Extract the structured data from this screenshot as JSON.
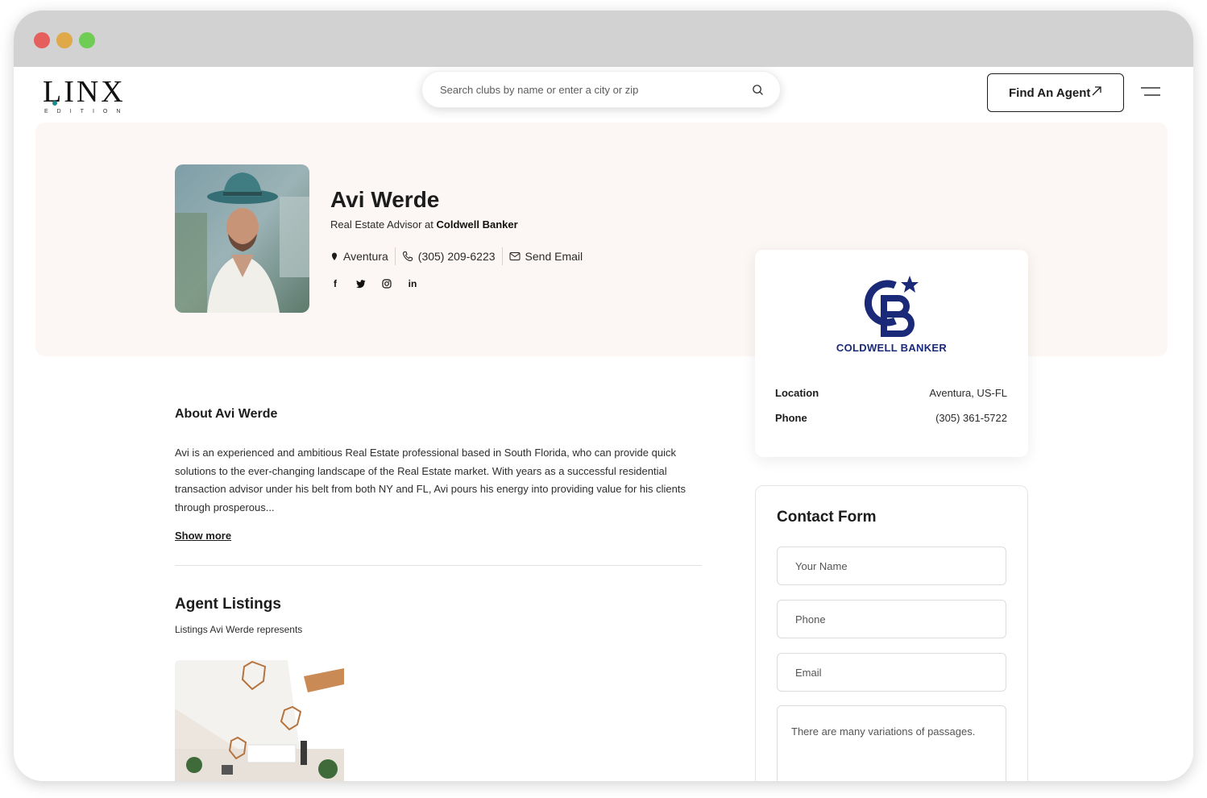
{
  "header": {
    "logo_text": "LINX",
    "logo_subtext": "EDITION",
    "search_placeholder": "Search clubs by name or enter a city or zip",
    "find_agent_label": "Find An Agent"
  },
  "agent": {
    "name": "Avi Werde",
    "role_prefix": "Real Estate Advisor at ",
    "company": "Coldwell Banker",
    "location": "Aventura",
    "phone": "(305) 209-6223",
    "email_label": "Send Email",
    "socials": [
      "facebook-icon",
      "twitter-icon",
      "instagram-icon",
      "linkedin-icon"
    ]
  },
  "company_card": {
    "brand_name": "COLDWELL BANKER",
    "brand_color": "#1b2a78",
    "location_label": "Location",
    "location_value": "Aventura, US-FL",
    "phone_label": "Phone",
    "phone_value": "(305) 361-5722"
  },
  "about": {
    "title": "About Avi Werde",
    "text": "Avi is an experienced and ambitious Real Estate professional based in South Florida, who can provide quick solutions to the ever-changing landscape of the Real Estate market. With years as a successful residential transaction advisor under his belt from both NY and FL, Avi pours his energy into providing value for his clients through prosperous...",
    "show_more": "Show more"
  },
  "listings": {
    "title": "Agent Listings",
    "subtitle": "Listings Avi Werde represents"
  },
  "contact_form": {
    "title": "Contact Form",
    "name_placeholder": "Your Name",
    "phone_placeholder": "Phone",
    "email_placeholder": "Email",
    "message_placeholder": "There are many variations of passages."
  }
}
